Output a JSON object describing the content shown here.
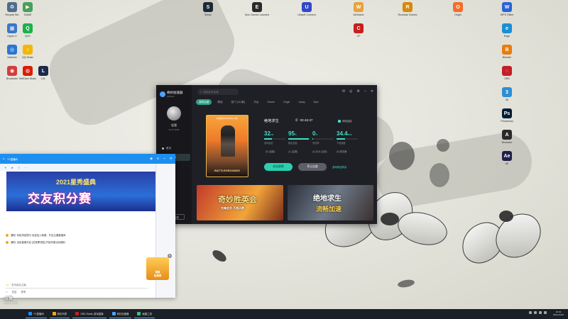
{
  "desktop": {
    "icons": [
      {
        "label": "Recycle Bin",
        "color": "#4d6e8a",
        "glyph": "♻"
      },
      {
        "label": "GAME",
        "color": "#4a9f5a",
        "glyph": "▶"
      },
      {
        "label": "Hyper-V",
        "color": "#3b78c7",
        "glyph": "▦"
      },
      {
        "label": "iQIYI",
        "color": "#19b24b",
        "glyph": "Q"
      },
      {
        "label": "Network",
        "color": "#2b76d2",
        "glyph": "◎"
      },
      {
        "label": "QQ Music",
        "color": "#f2b705",
        "glyph": "♪"
      },
      {
        "label": "Broadcast",
        "color": "#d43c3c",
        "glyph": "◉"
      },
      {
        "label": "NetEase Music",
        "color": "#d81e06",
        "glyph": "◍"
      },
      {
        "label": "LOL",
        "color": "#1b2a4a",
        "glyph": "L"
      },
      {
        "label": "Steam",
        "color": "#1b2838",
        "glyph": "S"
      },
      {
        "label": "Epic Games Launcher",
        "color": "#2a2a2a",
        "glyph": "E"
      },
      {
        "label": "Ubisoft Connect",
        "color": "#3347c8",
        "glyph": "U"
      },
      {
        "label": "WeGame",
        "color": "#e6a23c",
        "glyph": "W"
      },
      {
        "label": "CF",
        "color": "#c81e1e",
        "glyph": "C"
      },
      {
        "label": "Rockstar Games",
        "color": "#d68a0a",
        "glyph": "R"
      },
      {
        "label": "Origin",
        "color": "#f56c2d",
        "glyph": "O"
      },
      {
        "label": "WPS Office",
        "color": "#2a63d6",
        "glyph": "W"
      },
      {
        "label": "Edge",
        "color": "#1a8fd8",
        "glyph": "e"
      },
      {
        "label": "Blender",
        "color": "#e87d0d",
        "glyph": "B"
      },
      {
        "label": "OBS",
        "color": "#c21f2a",
        "glyph": "◌"
      },
      {
        "label": "3D",
        "color": "#2d8fd4",
        "glyph": "3"
      },
      {
        "label": "Photoshop",
        "color": "#001e36",
        "glyph": "Ps"
      },
      {
        "label": "Illustrator",
        "color": "#2a2a2a",
        "glyph": "A"
      },
      {
        "label": "AE",
        "color": "#1f1f4a",
        "glyph": "Ae"
      }
    ]
  },
  "accelerator": {
    "app_name": "奇妙加速器",
    "app_sub": "QIMIAO",
    "search_placeholder": "搜索游戏/加速",
    "user_name": "轻狸",
    "user_id": "ID:57 5848",
    "nav": [
      {
        "label": "首页"
      },
      {
        "label": "游戏加速"
      }
    ],
    "feedback": "问题反馈",
    "tabs": [
      "我的加速",
      "精选",
      "热门 (111款)",
      "平台",
      "Steam",
      "Origin",
      "Uplay",
      "Epic"
    ],
    "game_tag": "绝地求生(PUBG)Steam版",
    "game_brand": "BATTLEGROUNDS",
    "game_title": "绝地求生",
    "timer_label": "加速时长",
    "timer": "00:46:37",
    "net_mode": "网络连接",
    "stats": [
      {
        "value": "32",
        "unit": "ms",
        "label": "游戏延迟",
        "percent": 0.35
      },
      {
        "value": "95",
        "unit": "%",
        "label": "稳定性能",
        "percent": 0.95
      },
      {
        "value": "0",
        "unit": "%",
        "label": "丢包率",
        "percent": 0.02
      },
      {
        "value": "34.4",
        "unit": "kb/s",
        "label": "下载速度",
        "percent": 0.4
      }
    ],
    "options": [
      "(5) (线路)",
      "(1) (区服)",
      "(4) 亚洲 (全部)",
      "(5) 服务器"
    ],
    "primary_button": "启动游戏",
    "secondary_button": "停止加速",
    "link": "游戏商店购买",
    "banners": [
      {
        "text": "奇妙胜英会",
        "sub": "先锋会员 不限天数"
      },
      {
        "text": "绝地求生",
        "sub": "流畅加速"
      }
    ]
  },
  "chat": {
    "title": "YY直播间",
    "banner_line1": "2021星秀盛典",
    "banner_line2": "交友积分赛",
    "messages": [
      "通知: 系统消息提示 欢迎加入频道，开启主播直播间",
      "通知: 全民盛典开启 [去投票领奖] 开始专属活动福利"
    ],
    "promo": "领取\n免费券",
    "input_placeholder": "发消息给主播...",
    "footer": [
      "发送",
      "表情"
    ]
  },
  "taskbar": {
    "items": [
      {
        "label": "YY直播间",
        "color": "#1d8ff0"
      },
      {
        "label": "精彩列表",
        "color": "#f4a71d"
      },
      {
        "label": "OBS Studio 游戏直播",
        "color": "#c21f2a"
      },
      {
        "label": "奇妙加速器",
        "color": "#4aa3ff"
      },
      {
        "label": "画图工具",
        "color": "#3fbf7f"
      }
    ],
    "time": "23:03",
    "date": "2021/12/03"
  },
  "watermark": {
    "title": "斗鱼",
    "sub": "DOUYU.COM"
  }
}
